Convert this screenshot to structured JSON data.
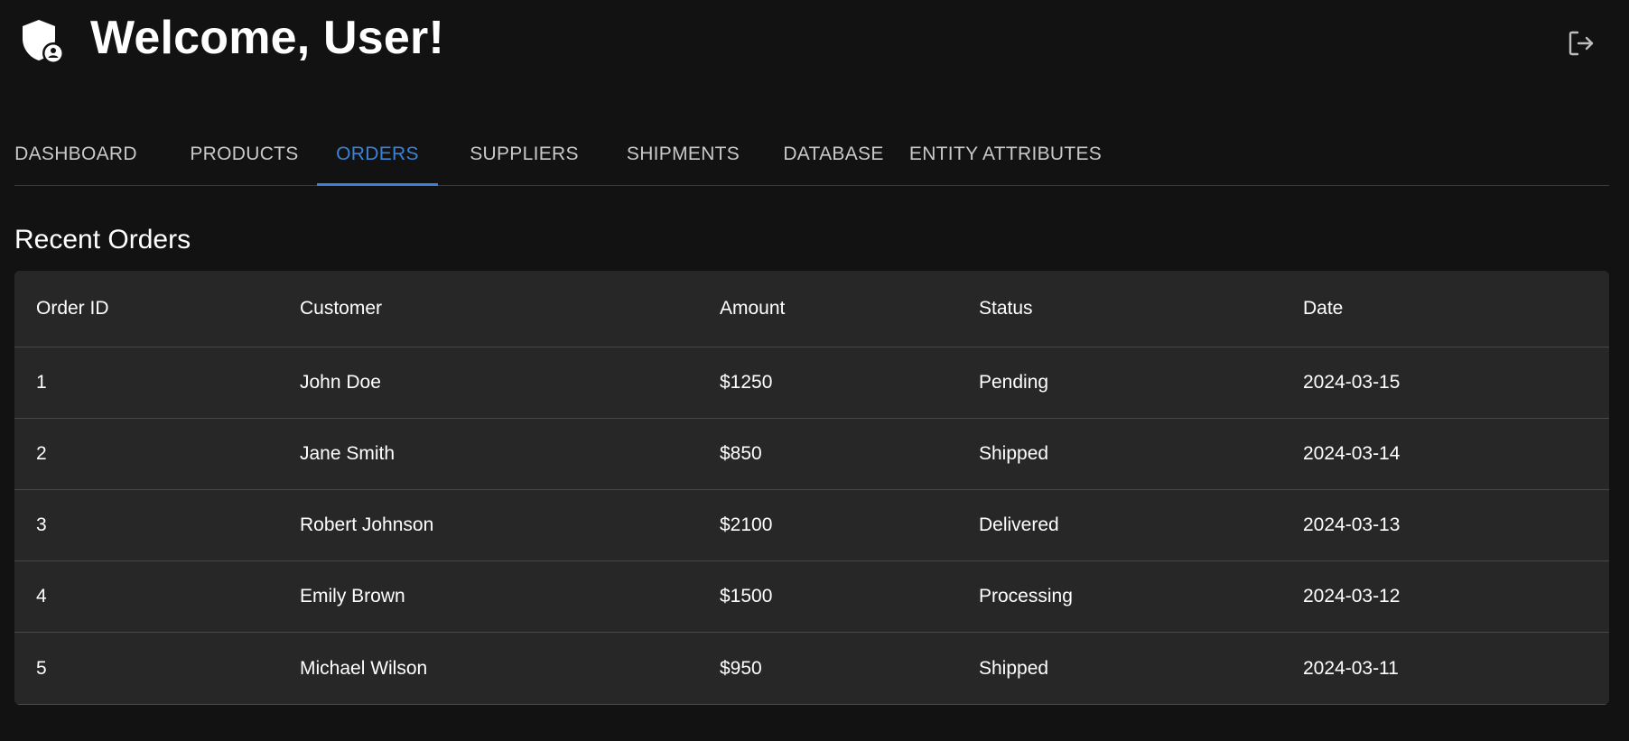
{
  "header": {
    "welcome": "Welcome, User!",
    "logo_icon": "shield-user-icon",
    "logout_icon": "logout-icon"
  },
  "tabs": [
    {
      "label": "DASHBOARD"
    },
    {
      "label": "PRODUCTS"
    },
    {
      "label": "ORDERS"
    },
    {
      "label": "SUPPLIERS"
    },
    {
      "label": "SHIPMENTS"
    },
    {
      "label": "DATABASE"
    },
    {
      "label": "ENTITY ATTRIBUTES"
    }
  ],
  "active_tab": "ORDERS",
  "section": {
    "title": "Recent Orders"
  },
  "table": {
    "columns": [
      "Order ID",
      "Customer",
      "Amount",
      "Status",
      "Date"
    ],
    "rows": [
      [
        "1",
        "John Doe",
        "$1250",
        "Pending",
        "2024-03-15"
      ],
      [
        "2",
        "Jane Smith",
        "$850",
        "Shipped",
        "2024-03-14"
      ],
      [
        "3",
        "Robert Johnson",
        "$2100",
        "Delivered",
        "2024-03-13"
      ],
      [
        "4",
        "Emily Brown",
        "$1500",
        "Processing",
        "2024-03-12"
      ],
      [
        "5",
        "Michael Wilson",
        "$950",
        "Shipped",
        "2024-03-11"
      ]
    ]
  },
  "colors": {
    "background": "#121212",
    "card": "#272727",
    "accent": "#3b82d6",
    "divider": "#474747"
  }
}
